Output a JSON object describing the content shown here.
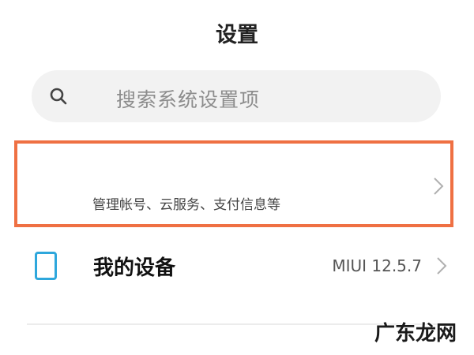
{
  "header": {
    "title": "设置"
  },
  "search": {
    "placeholder": "搜索系统设置项",
    "icon": "search-icon"
  },
  "account": {
    "subtitle": "管理帐号、云服务、支付信息等",
    "highlight_color": "#ef7043",
    "chevron_icon": "chevron-right-icon"
  },
  "device": {
    "label": "我的设备",
    "value": "MIUI 12.5.7",
    "icon": "phone-icon",
    "icon_color": "#2ea7dc",
    "chevron_icon": "chevron-right-icon"
  },
  "watermark": {
    "text": "广东龙网"
  }
}
